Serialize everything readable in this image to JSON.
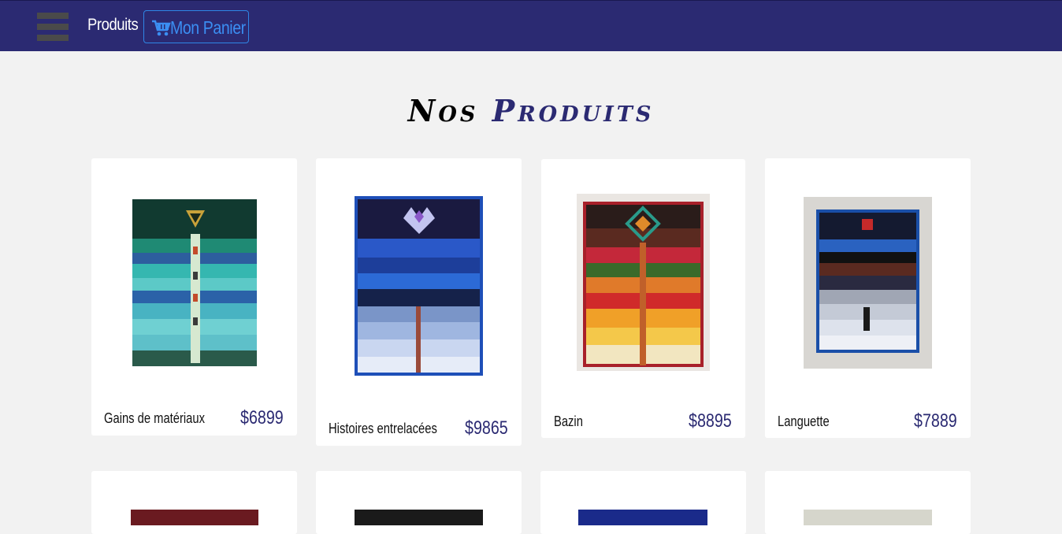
{
  "nav": {
    "products_label": "Produits",
    "cart_label": "Mon Panier",
    "menu_icon": "hamburger-menu-icon",
    "cart_icon": "shopping-cart-icon"
  },
  "page": {
    "title_word1": "Nos",
    "title_word2": "Produits"
  },
  "colors": {
    "navbar": "#2b2a72",
    "accent": "#3b8ef2",
    "price": "#2b2a72",
    "background": "#f2f2f2"
  },
  "products": [
    {
      "name": "Gains de matériaux",
      "price": "$6899"
    },
    {
      "name": "Histoires entrelacées",
      "price": "$9865"
    },
    {
      "name": "Bazin",
      "price": "$8895"
    },
    {
      "name": "Languette",
      "price": "$7889"
    }
  ]
}
